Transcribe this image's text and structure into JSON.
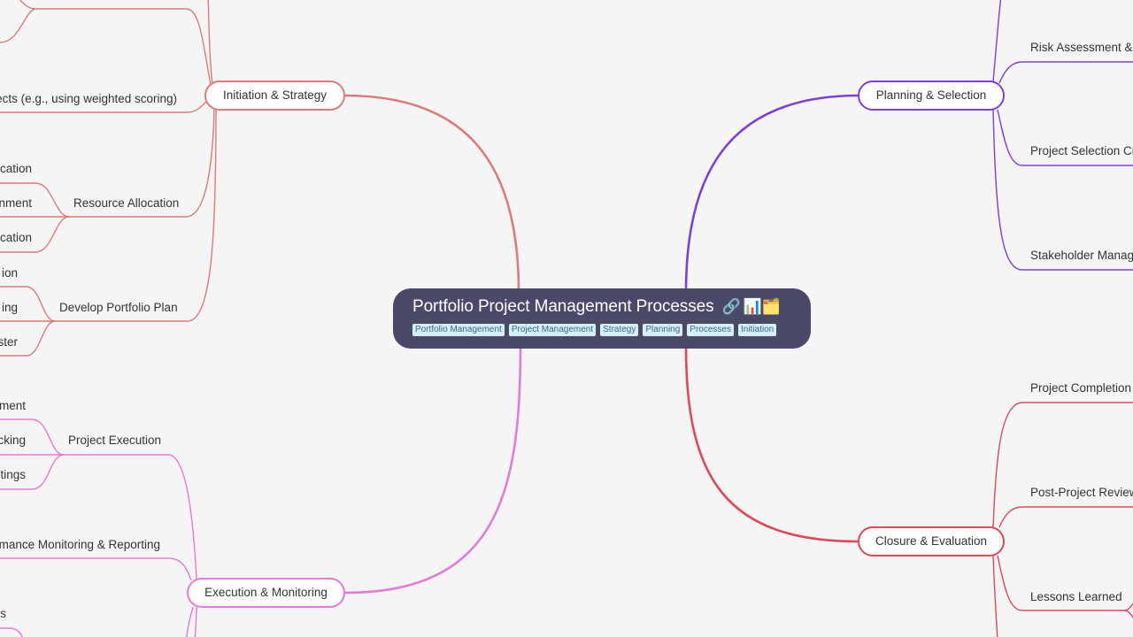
{
  "root": {
    "title": "Portfolio Project Management Processes",
    "icons": "🔗 📊🗂️",
    "icon_names": [
      "link-icon",
      "bar-chart-icon",
      "card-index-dividers-icon"
    ],
    "tags": [
      "Portfolio Management",
      "Project Management",
      "Strategy",
      "Planning",
      "Processes",
      "Initiation"
    ]
  },
  "colors": {
    "background": "#f5f5f5",
    "root_bg": "#4a4a68",
    "tag_bg": "#d5eef7",
    "tag_text": "#2f6f8a",
    "initiation": "#e07a7a",
    "planning": "#7b3fe4",
    "execution": "#e879d4",
    "closure": "#e0485a"
  },
  "branches": {
    "initiation": {
      "label": "Initiation & Strategy",
      "children": [
        {
          "label": "...jects (e.g., using weighted scoring)",
          "visible": "ects (e.g., using weighted scoring)"
        },
        {
          "label": "Resource Allocation",
          "children": [
            "cation",
            "nment",
            "cation"
          ]
        },
        {
          "label": "Develop Portfolio Plan",
          "children": [
            "ion",
            "ing",
            "ster"
          ]
        }
      ]
    },
    "execution": {
      "label": "Execution & Monitoring",
      "children": [
        {
          "label": "Project Execution",
          "children": [
            "ment",
            "cking",
            "tings"
          ]
        },
        {
          "label": "mance Monitoring & Reporting"
        },
        {
          "label": "s"
        }
      ]
    },
    "planning": {
      "label": "Planning & Selection",
      "children": [
        {
          "label": "Risk Assessment & I"
        },
        {
          "label": "Project Selection Cr"
        },
        {
          "label": "Stakeholder Manag"
        }
      ]
    },
    "closure": {
      "label": "Closure & Evaluation",
      "children": [
        {
          "label": "Project Completion"
        },
        {
          "label": "Post-Project Review"
        },
        {
          "label": "Lessons Learned"
        }
      ]
    }
  }
}
